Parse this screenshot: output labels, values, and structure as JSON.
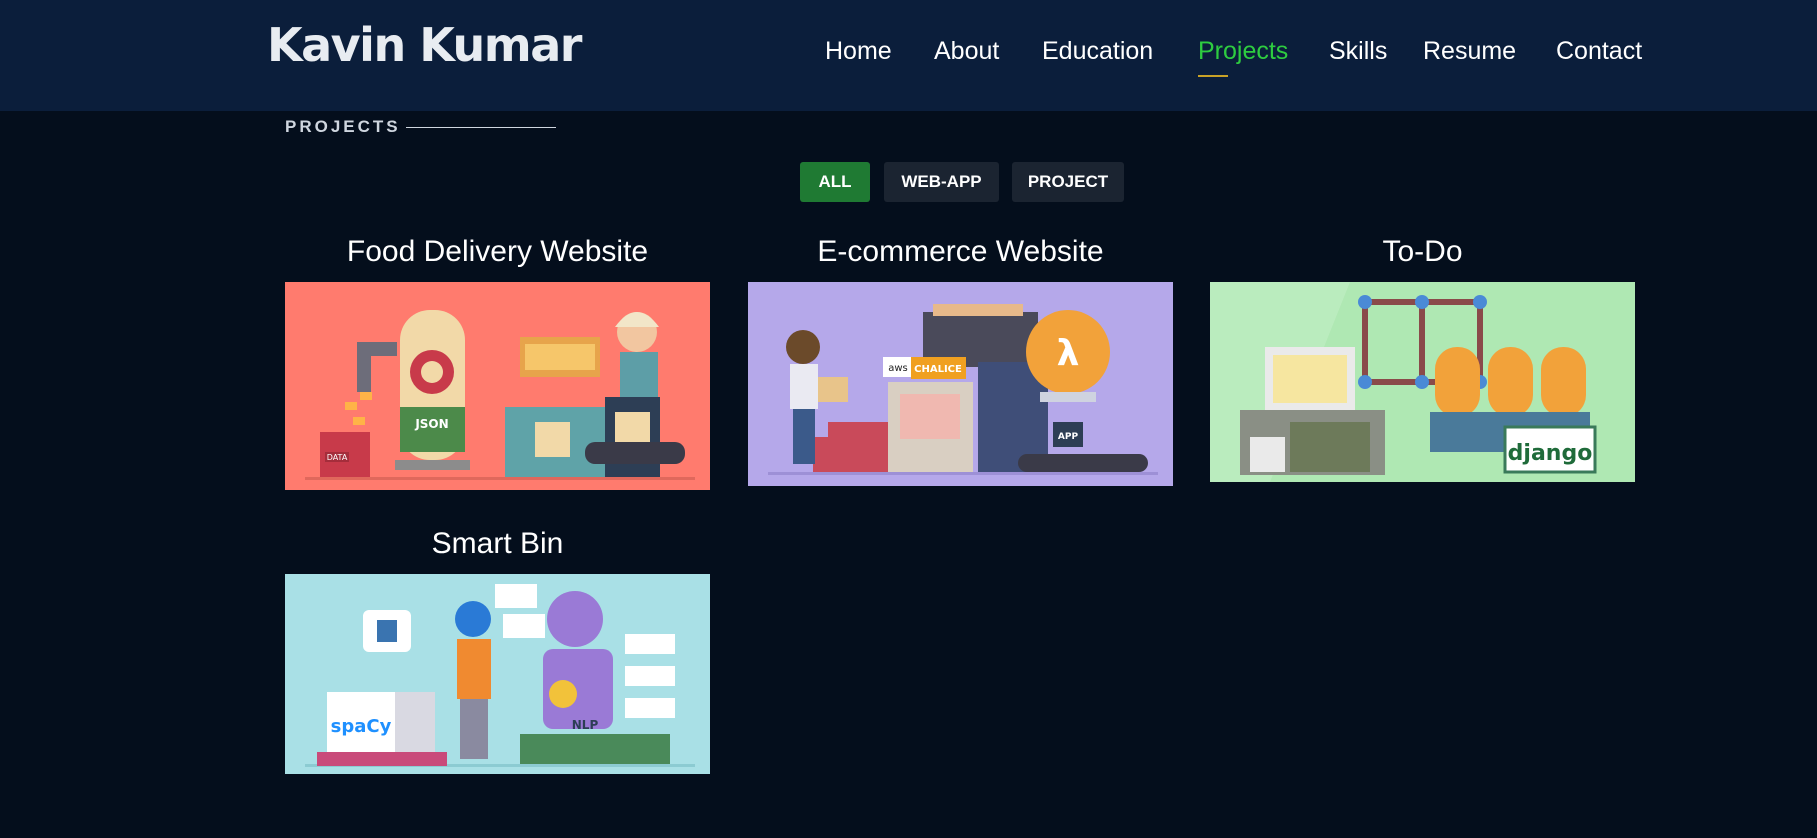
{
  "header": {
    "logo": "Kavin Kumar",
    "nav": [
      {
        "label": "Home",
        "active": false
      },
      {
        "label": "About",
        "active": false
      },
      {
        "label": "Education",
        "active": false
      },
      {
        "label": "Projects",
        "active": true
      },
      {
        "label": "Skills",
        "active": false
      },
      {
        "label": "Resume",
        "active": false
      },
      {
        "label": "Contact",
        "active": false
      }
    ]
  },
  "section": {
    "label": "PROJECTS"
  },
  "filters": [
    {
      "label": "ALL",
      "active": true
    },
    {
      "label": "WEB-APP",
      "active": false
    },
    {
      "label": "PROJECT",
      "active": false
    }
  ],
  "projects": [
    {
      "title": "Food Delivery Website",
      "image_bg": "#ff7b6e",
      "image_labels": [
        "JSON",
        "DATA"
      ]
    },
    {
      "title": "E-commerce Website",
      "image_bg": "#b5a8ea",
      "image_labels": [
        "aws",
        "CHALICE",
        "λ",
        "APP"
      ]
    },
    {
      "title": "To-Do",
      "image_bg": "#afe8b3",
      "image_labels": [
        "django"
      ]
    },
    {
      "title": "Smart Bin",
      "image_bg": "#a9e0e6",
      "image_labels": [
        "spaCy",
        "NLP"
      ]
    }
  ],
  "colors": {
    "accent": "#2ecc40",
    "header_bg": "#0b1e3b",
    "page_bg": "#040e1c"
  }
}
